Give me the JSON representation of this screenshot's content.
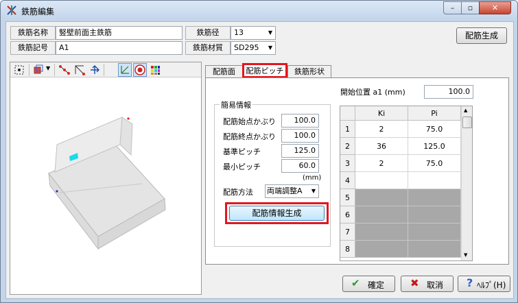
{
  "window": {
    "title": "鉄筋編集",
    "min_glyph": "–",
    "max_glyph": "▫",
    "close_glyph": "✕"
  },
  "header": {
    "name_label": "鉄筋名称",
    "name_value": "竪壁前面主鉄筋",
    "symbol_label": "鉄筋記号",
    "symbol_value": "A1",
    "diameter_label": "鉄筋径",
    "diameter_value": "13",
    "material_label": "鉄筋材質",
    "material_value": "SD295",
    "generate_label": "配筋生成"
  },
  "tabs": [
    {
      "label": "配筋面"
    },
    {
      "label": "配筋ピッチ"
    },
    {
      "label": "鉄筋形状"
    }
  ],
  "pitch": {
    "start_label": "開始位置 a1 (mm)",
    "start_value": "100.0",
    "group_title": "簡易情報",
    "rows": [
      {
        "label": "配筋始点かぶり",
        "value": "100.0"
      },
      {
        "label": "配筋終点かぶり",
        "value": "100.0"
      },
      {
        "label": "基準ピッチ",
        "value": "125.0"
      },
      {
        "label": "最小ピッチ",
        "value": "60.0"
      }
    ],
    "unit": "(mm)",
    "method_label": "配筋方法",
    "method_value": "両端調整A",
    "gen_button": "配筋情報生成"
  },
  "grid": {
    "columns": [
      "Ki",
      "Pi"
    ],
    "rows": [
      {
        "num": "1",
        "ki": "2",
        "pi": "75.0",
        "enabled": true
      },
      {
        "num": "2",
        "ki": "36",
        "pi": "125.0",
        "enabled": true
      },
      {
        "num": "3",
        "ki": "2",
        "pi": "75.0",
        "enabled": true
      },
      {
        "num": "4",
        "ki": "",
        "pi": "",
        "enabled": true
      },
      {
        "num": "5",
        "ki": "",
        "pi": "",
        "enabled": false
      },
      {
        "num": "6",
        "ki": "",
        "pi": "",
        "enabled": false
      },
      {
        "num": "7",
        "ki": "",
        "pi": "",
        "enabled": false
      },
      {
        "num": "8",
        "ki": "",
        "pi": "",
        "enabled": false
      }
    ]
  },
  "footer": {
    "ok_label": "確定",
    "cancel_label": "取消",
    "help_label": "ﾍﾙﾌﾟ(H)"
  },
  "colors": {
    "highlight": "#e2161e",
    "disabled_cell": "#a8a8a8",
    "ok_check": "#2a9a2a",
    "cancel_x": "#c81818",
    "help_icon": "#2a62c8"
  }
}
